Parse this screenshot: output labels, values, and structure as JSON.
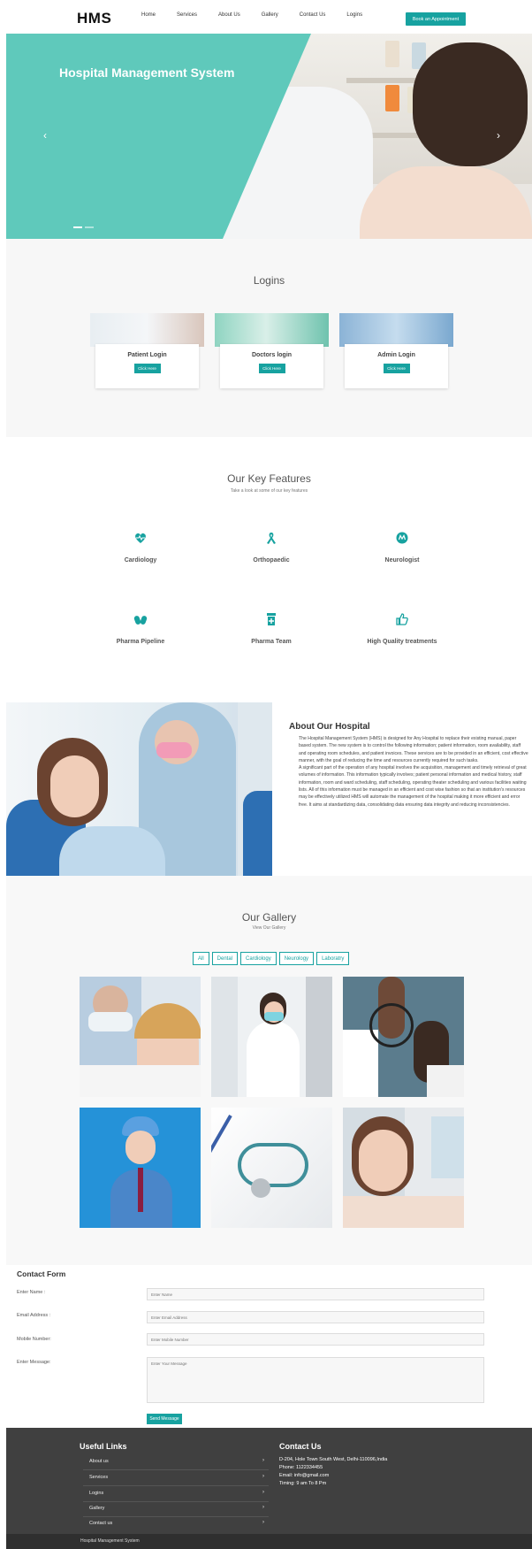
{
  "nav": {
    "brand": "HMS",
    "links": [
      "Home",
      "Services",
      "About Us",
      "Gallery",
      "Contact Us",
      "Logins"
    ],
    "cta": "Book an Appointment"
  },
  "hero": {
    "title": "Hospital Management System",
    "prev_icon": "chevron-left-icon",
    "next_icon": "chevron-right-icon"
  },
  "logins": {
    "title": "Logins",
    "cards": [
      {
        "label": "Patient Login",
        "button": "Click Here"
      },
      {
        "label": "Doctors login",
        "button": "Click Here"
      },
      {
        "label": "Admin Login",
        "button": "Click Here"
      }
    ]
  },
  "features": {
    "title": "Our Key Features",
    "subtitle": "Take a look at some of our key features",
    "items": [
      {
        "label": "Cardiology",
        "icon": "heartbeat-icon"
      },
      {
        "label": "Orthopaedic",
        "icon": "ribbon-icon"
      },
      {
        "label": "Neurologist",
        "icon": "brain-icon"
      },
      {
        "label": "Pharma Pipeline",
        "icon": "capsules-icon"
      },
      {
        "label": "Pharma Team",
        "icon": "prescription-bottle-icon"
      },
      {
        "label": "High Quality treatments",
        "icon": "thumbs-up-icon"
      }
    ],
    "accent": "#17a2a0"
  },
  "about": {
    "title": "About Our Hospital",
    "p1": "The Hospital Management System (HMS) is designed for Any Hospital to replace their existing manual, paper based system. The new system is to control the following information; patient information, room availability, staff and operating room schedules, and patient invoices. These services are to be provided in an efficient, cost effective manner, with the goal of reducing the time and resources currently required for such tasks.",
    "p2": "A significant part of the operation of any hospital involves the acquisition, management and timely retrieval of great volumes of information. This information typically involves; patient personal information and medical history, staff information, room and ward scheduling, staff scheduling, operating theater scheduling and various facilities waiting lists. All of this information must be managed in an efficient and cost wise fashion so that an institution's resources may be effectively utilized HMS will automate the management of the hospital making it more efficient and error free. It aims at standardizing data, consolidating data ensuring data integrity and reducing inconsistencies."
  },
  "gallery": {
    "title": "Our Gallery",
    "subtitle": "View Our Gallery",
    "filters": [
      "All",
      "Dental",
      "Cardiology",
      "Neurology",
      "Laboratry"
    ]
  },
  "contact_form": {
    "title": "Contact Form",
    "name_label": "Enter Name :",
    "name_placeholder": "Enter Name",
    "email_label": "Email Address :",
    "email_placeholder": "Enter Email Address",
    "mobile_label": "Mobile Number:",
    "mobile_placeholder": "Enter Mobile Number",
    "message_label": "Enter Message:",
    "message_placeholder": "Enter Your Message",
    "submit": "Send Message"
  },
  "footer": {
    "links_title": "Useful Links",
    "links": [
      "About us",
      "Services",
      "Logins",
      "Gallery",
      "Contact us"
    ],
    "contact_title": "Contact Us",
    "address": "D-204, Hole Town South West, Delhi-110096,India",
    "phone": "Phone: 1122334455",
    "email": "Email: info@gmail.com",
    "timing": "Timing: 9 am To 8 Pm",
    "copyright": "Hospital Management System"
  }
}
